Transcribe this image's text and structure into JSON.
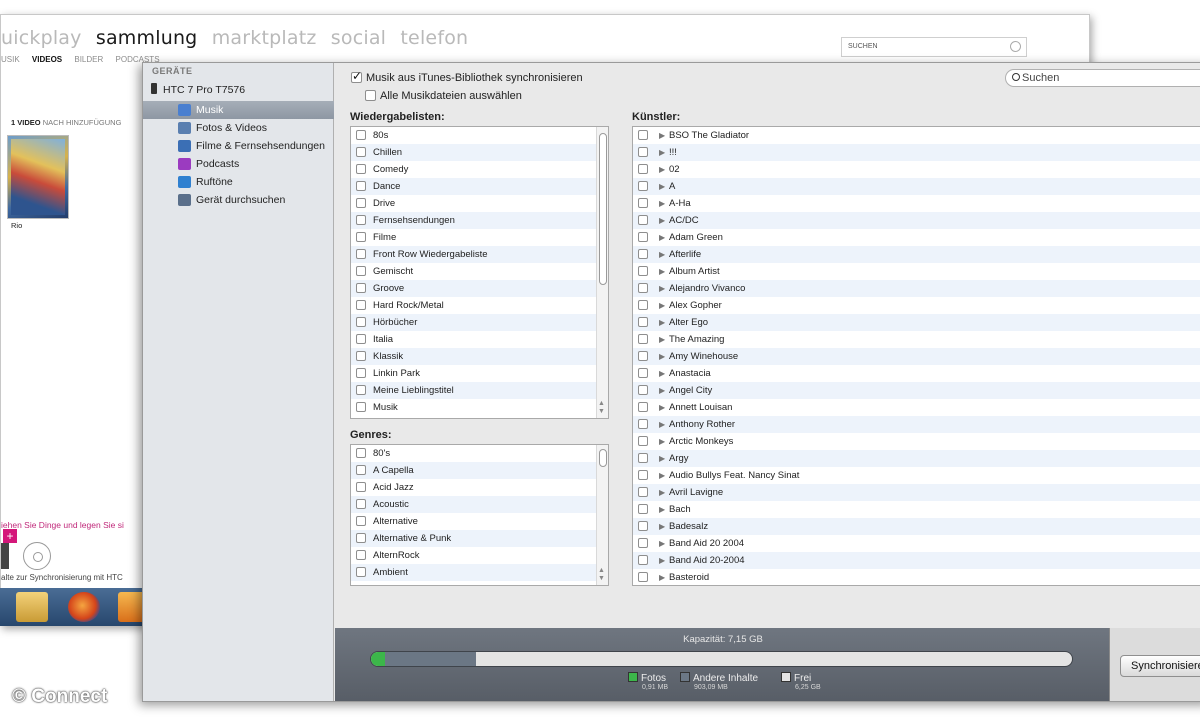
{
  "zune": {
    "nav": [
      "uickplay",
      "sammlung",
      "marktplatz",
      "social",
      "telefon"
    ],
    "nav_active_index": 1,
    "subnav": [
      "USIK",
      "VIDEOS",
      "BILDER",
      "PODCASTS"
    ],
    "subnav_active_index": 1,
    "search_placeholder": "SUCHEN",
    "count_bold": "1 VIDEO",
    "count_rest": "NACH HINZUFÜGUNG",
    "thumb_caption": "Rio",
    "drag_hint": "iehen Sie Dinge und legen Sie si",
    "plus_label": "+",
    "sync_hint": "alte zur Synchronisierung mit HTC"
  },
  "sidebar": {
    "section": "GERÄTE",
    "device": "HTC 7 Pro T7576",
    "items": [
      {
        "label": "Musik",
        "icon": "music-icon",
        "color": "#4a7fd0"
      },
      {
        "label": "Fotos & Videos",
        "icon": "photos-icon",
        "color": "#5a7fb0"
      },
      {
        "label": "Filme & Fernsehsendungen",
        "icon": "movies-icon",
        "color": "#3b6fb5"
      },
      {
        "label": "Podcasts",
        "icon": "podcast-icon",
        "color": "#9b3bc0"
      },
      {
        "label": "Ruftöne",
        "icon": "bell-icon",
        "color": "#2f80d0"
      },
      {
        "label": "Gerät durchsuchen",
        "icon": "browse-icon",
        "color": "#5a6f8a"
      }
    ],
    "selected_index": 0
  },
  "content": {
    "sync_checkbox_label": "Musik aus iTunes-Bibliothek synchronisieren",
    "sync_checked": true,
    "select_all_label": "Alle Musikdateien auswählen",
    "select_all_checked": false,
    "search_placeholder": "Suchen",
    "playlists_title": "Wiedergabelisten:",
    "playlists": [
      "80s",
      "Chillen",
      "Comedy",
      "Dance",
      "Drive",
      "Fernsehsendungen",
      "Filme",
      "Front Row Wiedergabeliste",
      "Gemischt",
      "Groove",
      "Hard Rock/Metal",
      "Hörbücher",
      "Italia",
      "Klassik",
      "Linkin Park",
      "Meine Lieblingstitel",
      "Musik"
    ],
    "genres_title": "Genres:",
    "genres": [
      "80's",
      "A Capella",
      "Acid Jazz",
      "Acoustic",
      "Alternative",
      "Alternative & Punk",
      "AlternRock",
      "Ambient"
    ],
    "artists_title": "Künstler:",
    "artists": [
      "BSO The Gladiator",
      "!!!",
      "02",
      "A",
      "A-Ha",
      "AC/DC",
      "Adam Green",
      "Afterlife",
      "Album Artist",
      "Alejandro Vivanco",
      "Alex Gopher",
      "Alter Ego",
      "The Amazing",
      "Amy Winehouse",
      "Anastacia",
      "Angel City",
      "Annett Louisan",
      "Anthony Rother",
      "Arctic Monkeys",
      "Argy",
      "Audio Bullys Feat. Nancy Sinat",
      "Avril Lavigne",
      "Bach",
      "Badesalz",
      "Band Aid 20 2004",
      "Band Aid 20-2004",
      "Basteroid"
    ]
  },
  "capacity": {
    "title": "Kapazität: 7,15 GB",
    "photos_fraction": 0.002,
    "other_fraction": 0.13,
    "legend": [
      {
        "label": "Fotos",
        "size": "0,91 MB",
        "color": "#3cb64a"
      },
      {
        "label": "Andere Inhalte",
        "size": "903,09 MB",
        "color": "#6b7785"
      },
      {
        "label": "Frei",
        "size": "6,25 GB",
        "color": "#e4e4e4"
      }
    ],
    "sync_button": "Synchronisieren"
  },
  "watermark": "© Connect"
}
